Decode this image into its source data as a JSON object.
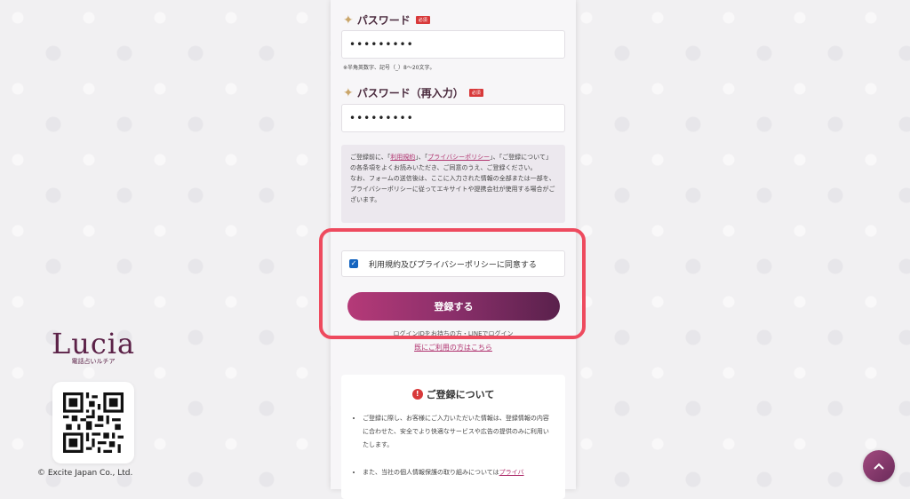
{
  "brand": {
    "logo_text": "Lucia",
    "logo_sub": "電話占いルチア",
    "copyright": "© Excite Japan Co., Ltd."
  },
  "form": {
    "password": {
      "label": "パスワード",
      "required_badge": "必須",
      "value": "•••••••••",
      "hint": "※半角英数字、記号（_）8〜20文字。"
    },
    "password_confirm": {
      "label": "パスワード（再入力）",
      "required_badge": "必須",
      "value": "•••••••••"
    },
    "notice": {
      "line1_prefix": "ご登録前に、「",
      "terms_link": "利用規約",
      "line1_mid": "」、「",
      "privacy_link": "プライバシーポリシー",
      "line1_suffix": "」、「ご登録について」の各条項をよくお読みいただき、ご同意のうえ、ご登録ください。",
      "line2": "なお、フォームの送信後は、ここに入力された情報の全部または一部を、プライバシーポリシーに従ってエキサイトや提携会社が使用する場合がございます。"
    },
    "agree_label": "利用規約及びプライバシーポリシーに同意する",
    "agree_checked": true,
    "submit_label": "登録する",
    "line_login_text": "ログインIDをお持ちの方・LINEでログイン",
    "member_link": "既にご利用の方はこちら"
  },
  "info": {
    "title": "ご登録について",
    "items": [
      "ご登録に際し、お客様にご入力いただいた情報は、登録情報の内容に合わせた、安全でより快適なサービスや広告の提供のみに利用いたします。",
      "また、当社の個人情報保護の取り組みについては"
    ],
    "item2_link": "プライバ"
  }
}
